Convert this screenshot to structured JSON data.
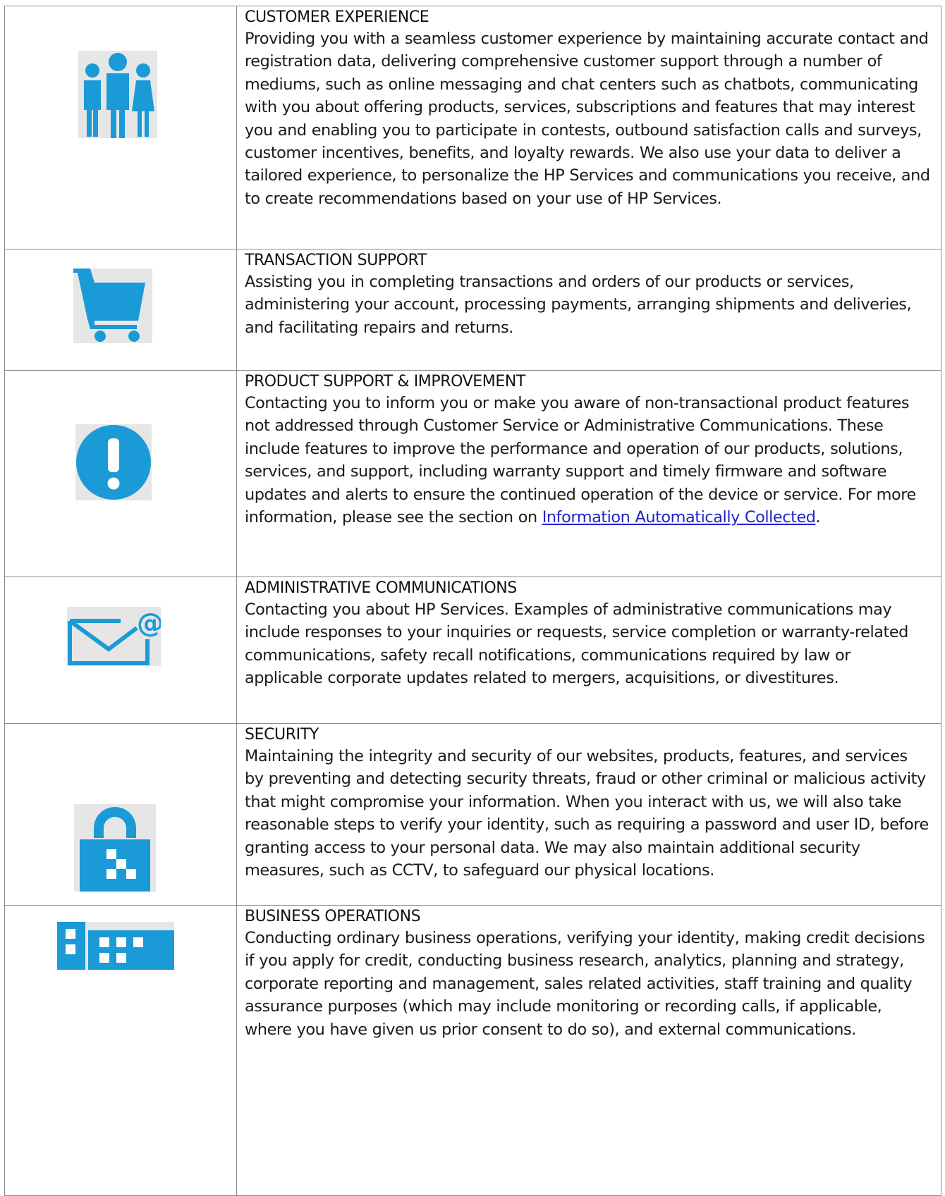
{
  "sections": [
    {
      "heading": "CUSTOMER EXPERIENCE",
      "icon": "people-group-icon",
      "body": "Providing you with a seamless customer experience by maintaining accurate contact and registration data, delivering comprehensive customer support through a number of mediums, such as online messaging and chat centers such as chatbots, communicating with you about offering products, services, subscriptions and features that may interest you and enabling you to participate in contests, outbound satisfaction calls and surveys, customer incentives, benefits, and loyalty rewards. We also use your data to deliver a tailored experience, to personalize the HP Services and communications you receive, and to create recommendations based on your use of HP Services."
    },
    {
      "heading": "TRANSACTION SUPPORT",
      "icon": "shopping-cart-icon",
      "body": "Assisting you in completing transactions and orders of our products or services, administering your account, processing payments, arranging shipments and deliveries, and facilitating repairs and returns."
    },
    {
      "heading": "PRODUCT SUPPORT & IMPROVEMENT",
      "icon": "exclamation-circle-icon",
      "body_before_link": "Contacting you to inform you or make you aware of non-transactional product features not addressed through Customer Service or Administrative Communications. These include features to improve the performance and operation of our products, solutions, services, and support, including warranty support and timely firmware and software updates and alerts to ensure the continued operation of the device or service. For more information, please see the section on ",
      "link_text": "Information Automatically Collected",
      "body_after_link": "."
    },
    {
      "heading": "ADMINISTRATIVE COMMUNICATIONS",
      "icon": "email-at-icon",
      "body": "Contacting you about HP Services. Examples of administrative communications may include responses to your inquiries or requests, service completion or warranty-related communications, safety recall notifications, communications required by law or applicable corporate updates related to mergers, acquisitions, or divestitures."
    },
    {
      "heading": "SECURITY",
      "icon": "padlock-icon",
      "body": "Maintaining the integrity and security of our websites, products, features, and services by preventing and detecting security threats, fraud or other criminal or malicious activity that might compromise your information. When you interact with us, we will also take reasonable steps to verify your identity, such as requiring a password and user ID, before granting access to your personal data. We may also maintain additional security measures, such as CCTV, to safeguard our physical locations."
    },
    {
      "heading": "BUSINESS OPERATIONS",
      "icon": "office-buildings-icon",
      "body": "Conducting ordinary business operations, verifying your identity, making credit decisions if you apply for credit, conducting business research, analytics, planning and strategy, corporate reporting and management, sales related activities, staff training and quality assurance purposes (which may include monitoring or recording calls, if applicable, where you have given us prior consent to do so), and external communications."
    }
  ],
  "colors": {
    "icon_blue": "#1a9ad6",
    "icon_bg": "#e6e6e6",
    "border": "#8c8c8c",
    "link": "#2222cc"
  }
}
